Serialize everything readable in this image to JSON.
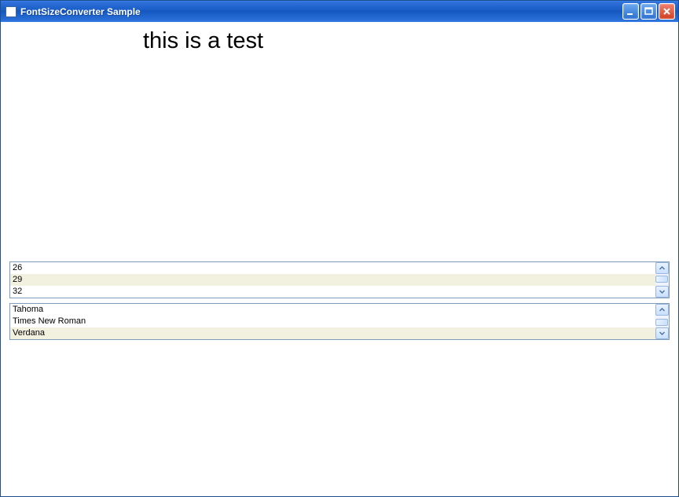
{
  "window": {
    "title": "FontSizeConverter Sample"
  },
  "sample_text": "this is a test",
  "size_list": {
    "items": [
      "26",
      "29",
      "32"
    ],
    "selected_index": 1
  },
  "font_list": {
    "items": [
      "Tahoma",
      "Times New Roman",
      "Verdana"
    ],
    "selected_index": 2
  }
}
